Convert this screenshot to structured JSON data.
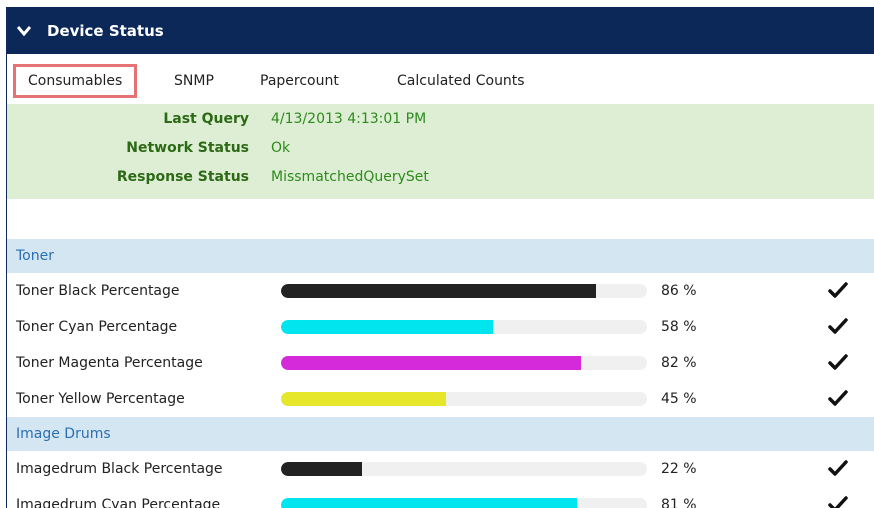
{
  "header": {
    "title": "Device Status"
  },
  "tabs": [
    {
      "label": "Consumables",
      "active": true
    },
    {
      "label": "SNMP"
    },
    {
      "label": "Papercount"
    },
    {
      "label": "Calculated Counts"
    }
  ],
  "info": [
    {
      "label": "Last Query",
      "value": "4/13/2013 4:13:01 PM"
    },
    {
      "label": "Network Status",
      "value": "Ok"
    },
    {
      "label": "Response Status",
      "value": "MissmatchedQuerySet"
    }
  ],
  "sections": [
    {
      "title": "Toner",
      "items": [
        {
          "name": "Toner Black Percentage",
          "percent": 86,
          "percent_text": "86 %",
          "color": "#222222"
        },
        {
          "name": "Toner Cyan Percentage",
          "percent": 58,
          "percent_text": "58 %",
          "color": "#00e5ee"
        },
        {
          "name": "Toner Magenta Percentage",
          "percent": 82,
          "percent_text": "82 %",
          "color": "#d42ad9"
        },
        {
          "name": "Toner Yellow Percentage",
          "percent": 45,
          "percent_text": "45 %",
          "color": "#e6e62a"
        }
      ]
    },
    {
      "title": "Image Drums",
      "items": [
        {
          "name": "Imagedrum Black Percentage",
          "percent": 22,
          "percent_text": "22 %",
          "color": "#222222"
        },
        {
          "name": "Imagedrum Cyan Percentage",
          "percent": 81,
          "percent_text": "81 %",
          "color": "#00e5ee"
        }
      ]
    }
  ],
  "icons": {
    "collapse": "chevron-down-icon",
    "status": "checkmark-icon"
  },
  "colors": {
    "header_bg": "#0b2858",
    "info_bg": "#ddeed4",
    "section_bg": "#d5e6f3",
    "active_tab_border": "#e57373"
  }
}
